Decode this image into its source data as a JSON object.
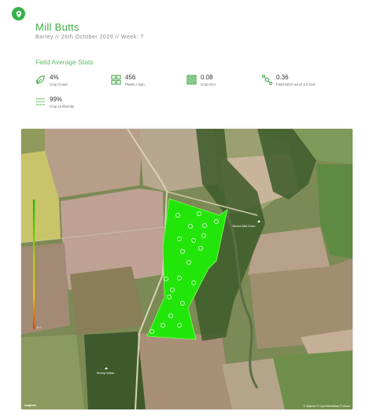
{
  "header": {
    "title": "Mill Butts",
    "subtitle": "Barley // 26th October 2020 // Week: 7",
    "logo_icon": "map-pin-icon",
    "brand_color": "#33b249"
  },
  "stats_section": {
    "title": "Field Average Stats",
    "items": [
      {
        "id": "crop-cover",
        "value": "4%",
        "label": "Crop Cover",
        "icon": "leaf-icon"
      },
      {
        "id": "plants",
        "value": "456",
        "label": "Plants / sqm",
        "icon": "grid-icon"
      },
      {
        "id": "gai",
        "value": "0.08",
        "label": "Crop GAI",
        "icon": "hatch-square-icon"
      },
      {
        "id": "ndvi",
        "value": "0.36",
        "label": "Field NDVI as of Jul 21st",
        "icon": "satellite-icon"
      },
      {
        "id": "uniformity",
        "value": "99%",
        "label": "Crop Uniformity",
        "icon": "rows-icon"
      }
    ]
  },
  "map": {
    "legend_min": "0.0",
    "legend_colors": [
      "#00c400",
      "#a8d800",
      "#f0c000",
      "#e63c00"
    ],
    "field_color": "#22e60a",
    "place_labels": [
      "Beech Mill Farm",
      "Sheep Wash"
    ],
    "mapbox_label": "mapbox",
    "attribution": "© Mapbox © OpenStreetMap © Maxar"
  }
}
